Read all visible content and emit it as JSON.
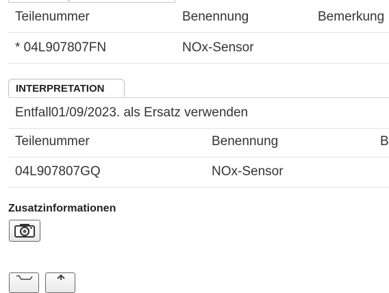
{
  "original_table": {
    "headers": [
      "Teilenummer",
      "Benennung",
      "Bemerkung"
    ],
    "rows": [
      {
        "part_number": "* 04L907807FN",
        "name": "NOx-Sensor"
      }
    ]
  },
  "interpretation": {
    "tab_label": "INTERPRETATION",
    "note": "Entfall01/09/2023. als Ersatz verwenden",
    "headers": [
      "Teilenummer",
      "Benennung",
      "B"
    ],
    "rows": [
      {
        "part_number": "04L907807GQ",
        "name": "NOx-Sensor"
      }
    ]
  },
  "additional_info": {
    "title": "Zusatzinformationen",
    "icons": [
      "camera-icon"
    ]
  },
  "bottom_toolbar": {
    "icons": [
      "cart-icon",
      "upload-icon"
    ]
  }
}
